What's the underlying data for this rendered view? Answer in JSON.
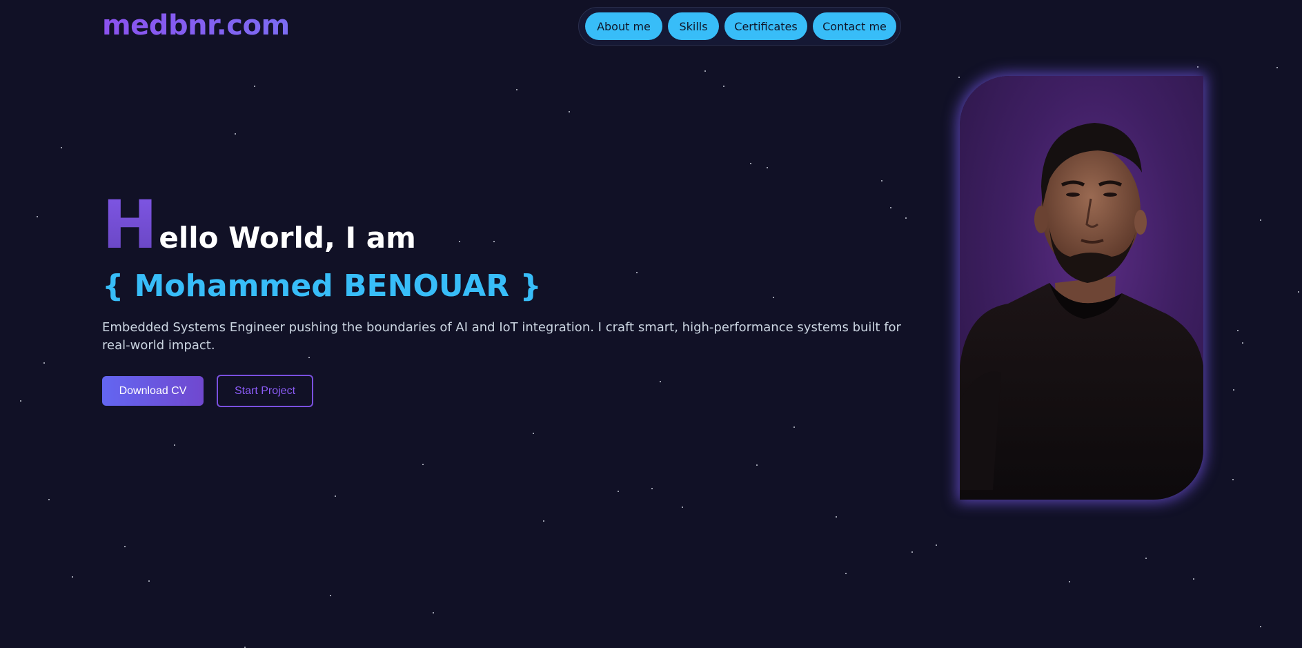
{
  "logo": {
    "text": "medbnr.com"
  },
  "nav": {
    "items": [
      {
        "label": "About me"
      },
      {
        "label": "Skills"
      },
      {
        "label": "Certificates"
      },
      {
        "label": "Contact me"
      }
    ]
  },
  "hero": {
    "title_first_letter": "H",
    "title_rest": "ello World, I am",
    "name": "{ Mohammed BENOUAR }",
    "tagline": "Embedded Systems Engineer pushing the boundaries of AI and IoT integration. I craft smart, high-performance systems built for real-world impact.",
    "primary_button": "Download CV",
    "secondary_button": "Start Project"
  },
  "colors": {
    "background": "#111126",
    "accent_cyan": "#38bdf8",
    "accent_purple": "#7c5cf6"
  },
  "icons": {
    "portrait": "profile-photo"
  }
}
